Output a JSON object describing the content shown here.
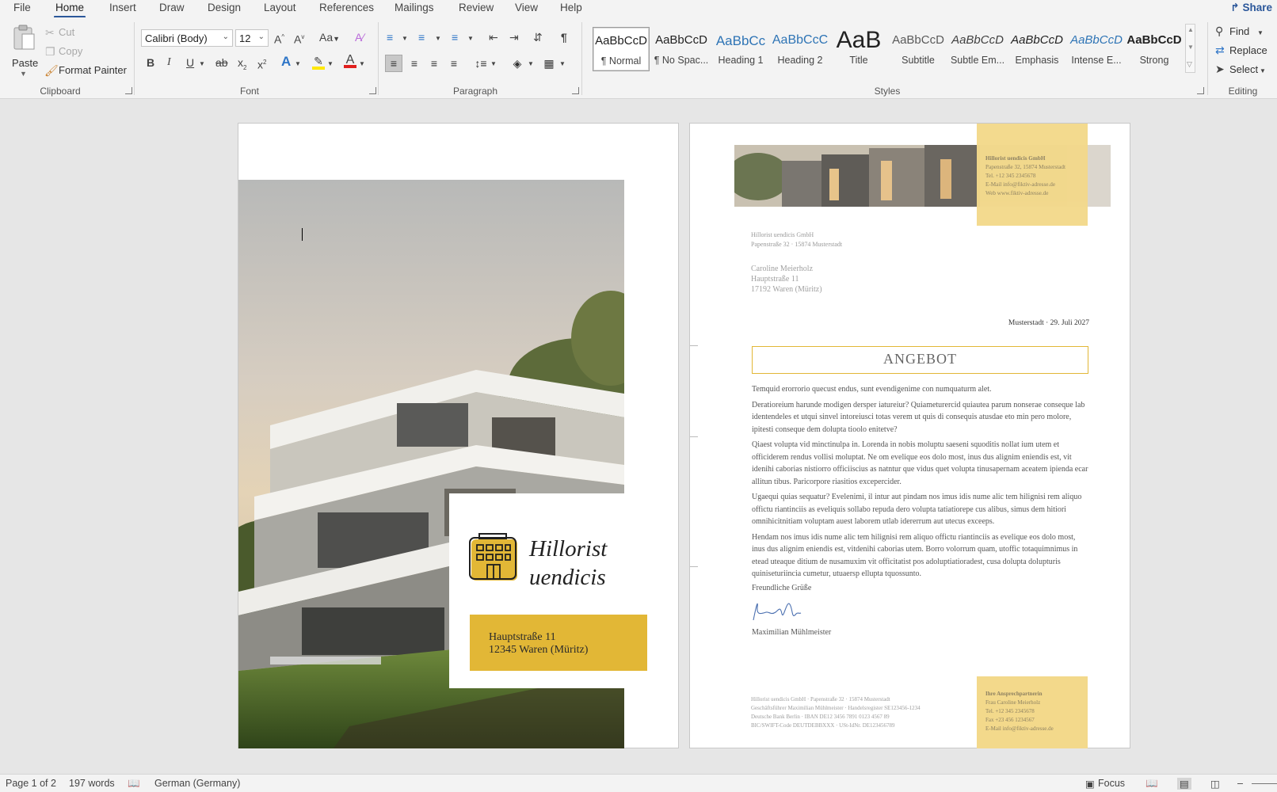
{
  "tabs": [
    "File",
    "Home",
    "Insert",
    "Draw",
    "Design",
    "Layout",
    "References",
    "Mailings",
    "Review",
    "View",
    "Help"
  ],
  "share_label": "Share",
  "clipboard": {
    "paste": "Paste",
    "cut": "Cut",
    "copy": "Copy",
    "format_painter": "Format Painter",
    "group": "Clipboard"
  },
  "font": {
    "name": "Calibri (Body)",
    "size": "12",
    "group": "Font"
  },
  "paragraph": {
    "group": "Paragraph"
  },
  "styles": {
    "group": "Styles",
    "items": [
      {
        "preview": "AaBbCcD",
        "name": "¶ Normal"
      },
      {
        "preview": "AaBbCcD",
        "name": "¶ No Spac..."
      },
      {
        "preview": "AaBbCc",
        "name": "Heading 1"
      },
      {
        "preview": "AaBbCcC",
        "name": "Heading 2"
      },
      {
        "preview": "AaB",
        "name": "Title"
      },
      {
        "preview": "AaBbCcD",
        "name": "Subtitle"
      },
      {
        "preview": "AaBbCcD",
        "name": "Subtle Em..."
      },
      {
        "preview": "AaBbCcD",
        "name": "Emphasis"
      },
      {
        "preview": "AaBbCcD",
        "name": "Intense E..."
      },
      {
        "preview": "AaBbCcD",
        "name": "Strong"
      }
    ]
  },
  "editing": {
    "group": "Editing",
    "find": "Find",
    "replace": "Replace",
    "select": "Select"
  },
  "colors": {
    "accent": "#2b579a",
    "gold": "#e2b736",
    "gold_light": "#f3d98b",
    "highlight": "#ffe800",
    "font_red": "#e0201e"
  },
  "page1": {
    "company_line1": "Hillorist",
    "company_line2": "uendicis",
    "address_line1": "Hauptstraße 11",
    "address_line2": "12345 Waren (Müritz)"
  },
  "page2": {
    "header_company": "Hillorist uendicis GmbH",
    "header_lines": [
      "Papenstraße 32, 15874 Musterstadt",
      "Tel. +12 345 2345678",
      "E-Mail info@fiktiv-adresse.de",
      "Web www.fiktiv-adresse.de"
    ],
    "sender_line1": "Hillorist uendicis GmbH",
    "sender_line2": "Papenstraße 32 · 15874 Musterstadt",
    "recipient": [
      "Caroline Meierholz",
      "Hauptstraße 11",
      "17192 Waren (Müritz)"
    ],
    "date": "Musterstadt · 29. Juli 2027",
    "title": "ANGEBOT",
    "paragraphs": [
      "Temquid erorrorio quecust endus, sunt evendigenime con numquaturm alet.",
      "Deratioreium harunde modigen dersper iatureiur? Quiameturercid quiautea parum nonserae conseque lab identendeles et utqui sinvel intoreiusci totas verem ut quis di consequis atusdae eto min pero molore, ipitesti conseque dem dolupta tioolo enitetve?",
      "Qiaest volupta vid minctinulpa in. Lorenda in nobis moluptu saeseni squoditis nollat ium utem et officiderem rendus vollisi moluptat. Ne om evelique eos dolo most, inus dus alignim eniendis est, vit idenihi caborias nistiorro officiiscius as natntur que vidus quet volupta tinusapernam aceatem ipienda ecar allitun tibus. Paricorpore riasitios excepercider.",
      "Ugaequi quias sequatur? Evelenimi, il intur aut pindam nos imus idis nume alic tem hilignisi rem aliquo offictu riantinciis as eveliquis sollabo repuda dero volupta tatiatiorepe cus alibus, simus dem hitiori omnihicitnitiam voluptam auest laborem utlab idererrum aut utecus exceeps.",
      "Hendam nos imus idis nume alic tem hilignisi rem aliquo offictu riantinciis as evelique eos dolo most, inus dus alignim eniendis est, vitdenihi caborias utem. Borro volorrum quam, utoffic totaquimnimus in etead uteaque ditium de nusamuxim vit officitatist pos adoluptiatioradest, cusa dolupta dolupturis quiniseturiincia cumetur, utuaersp ellupta tquossunto."
    ],
    "closing": "Freundliche Grüße",
    "signer": "Maximilian Mühlmeister",
    "footer_lines": [
      "Hillorist uendicis GmbH · Papenstraße 32 · 15874 Musterstadt",
      "Geschäftsführer Maximilian Mühlmeister · Handelsregister SE123456-1234",
      "Deutsche Bank Berlin · IBAN DE12 3456 7891 0123 4567 89",
      "BIC/SWIFT-Code DEUTDEBBXXX · USt-IdNr. DE123456789"
    ],
    "contact_title": "Ihre Ansprechpartnerin",
    "contact_lines": [
      "Frau Caroline Meierholz",
      "Tel. +12 345 2345678",
      "Fax +23 456 1234567",
      "E-Mail info@fiktiv-adresse.de"
    ]
  },
  "status": {
    "page": "Page 1 of 2",
    "words": "197 words",
    "language": "German (Germany)",
    "focus": "Focus"
  }
}
